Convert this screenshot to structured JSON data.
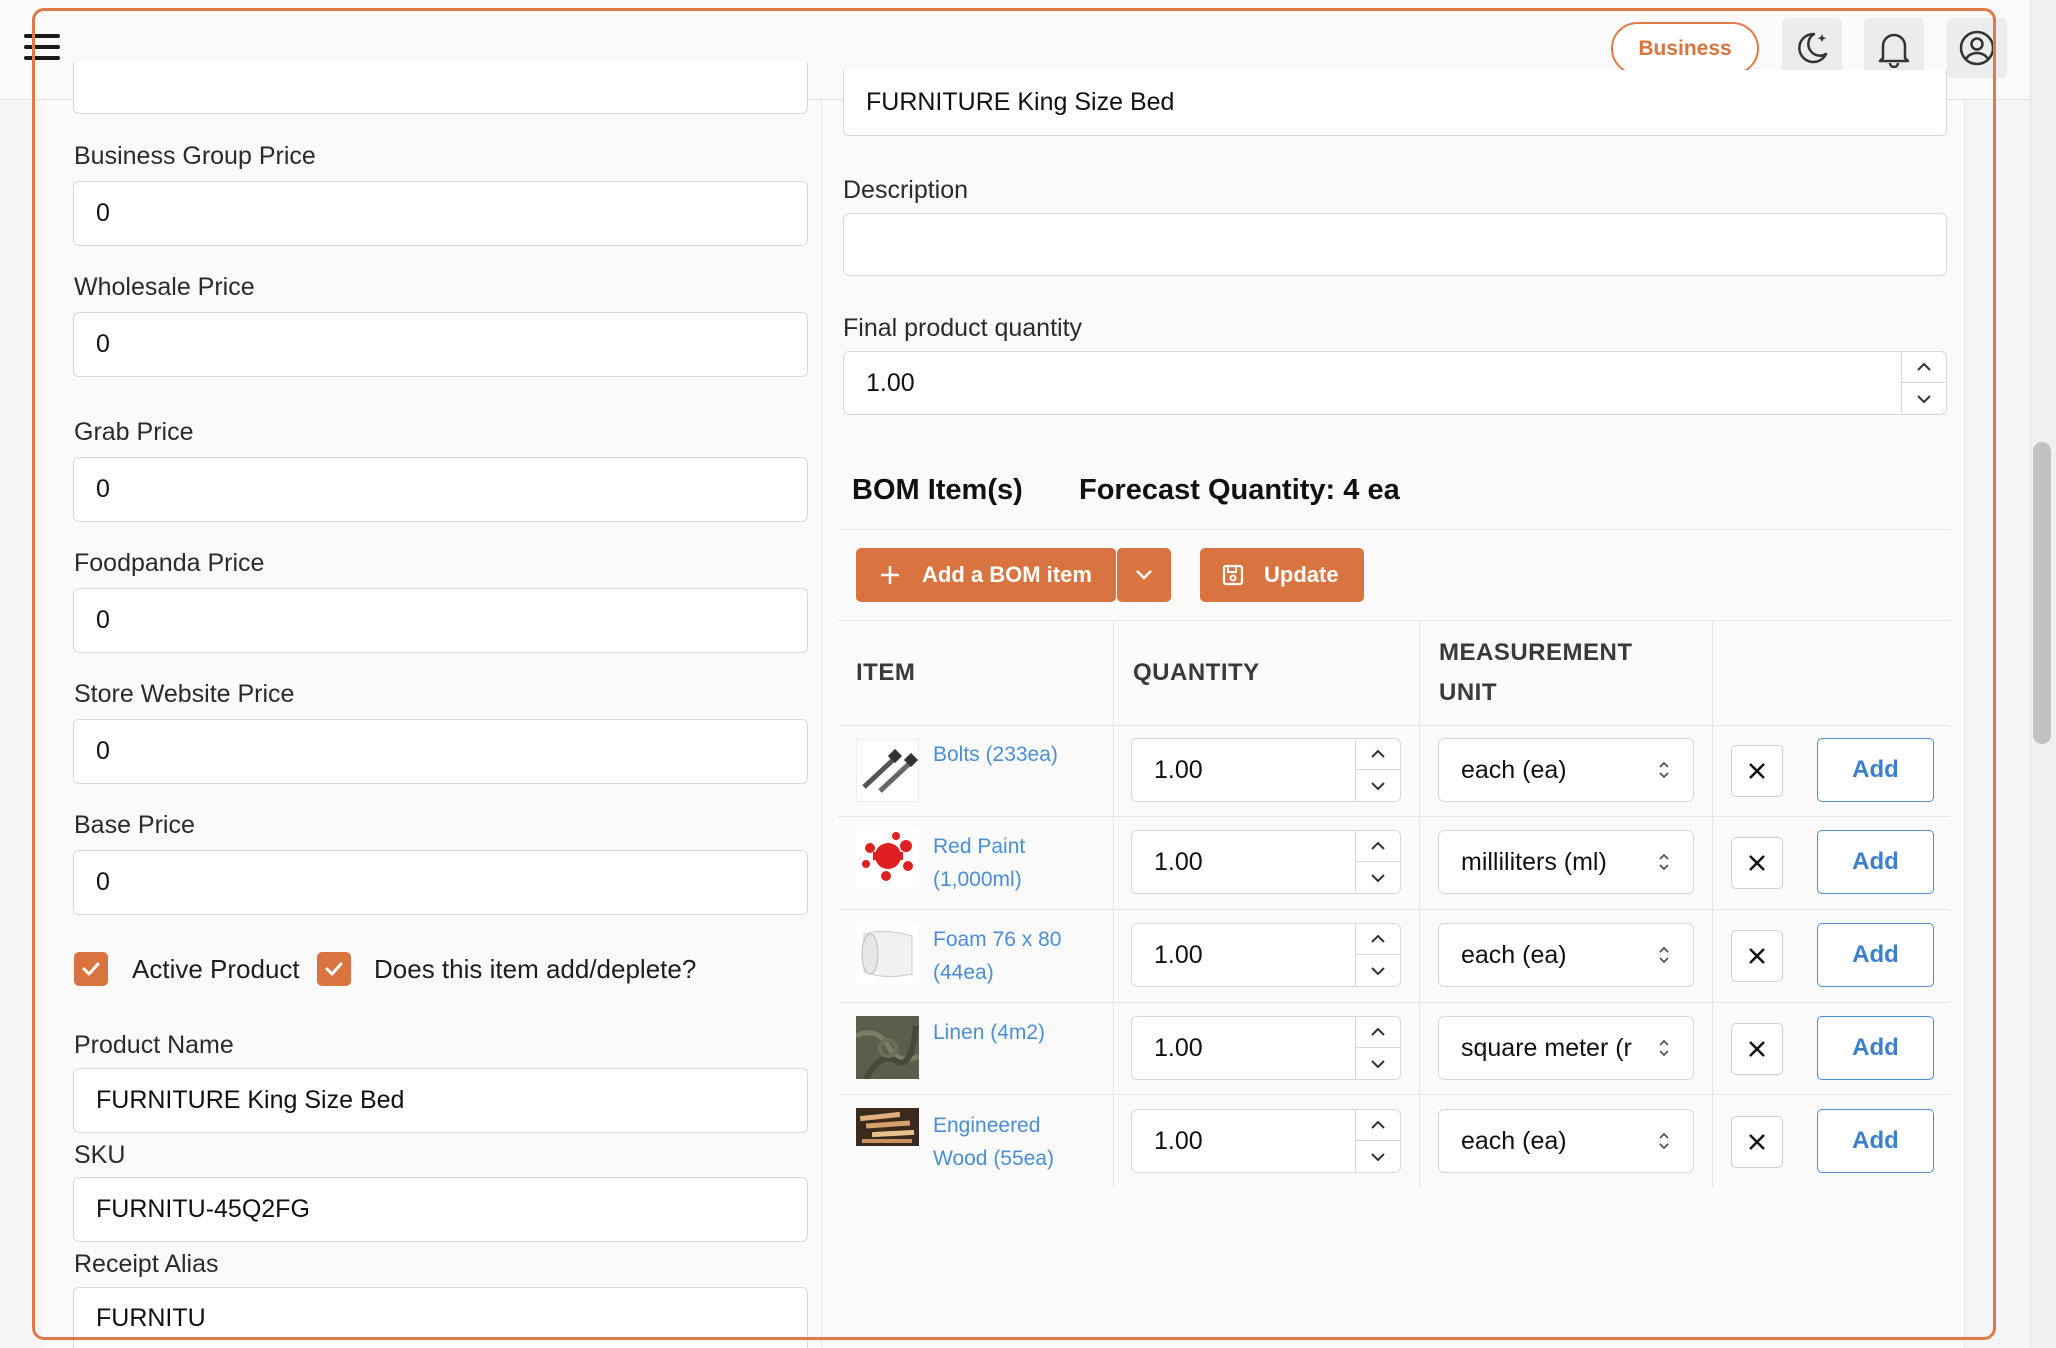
{
  "header": {
    "business_label": "Business",
    "icons": [
      "menu-icon",
      "moon-icon",
      "bell-icon",
      "user-icon"
    ]
  },
  "left": {
    "fields": [
      {
        "label": "Business Group Price",
        "value": "0"
      },
      {
        "label": "Wholesale Price",
        "value": "0"
      },
      {
        "label": "Grab Price",
        "value": "0"
      },
      {
        "label": "Foodpanda Price",
        "value": "0"
      },
      {
        "label": "Store Website Price",
        "value": "0"
      },
      {
        "label": "Base Price",
        "value": "0"
      }
    ],
    "active_product_label": "Active Product",
    "add_deplete_label": "Does this item add/deplete?",
    "product_name_label": "Product Name",
    "product_name_value": "FURNITURE King Size Bed",
    "sku_label": "SKU",
    "sku_value": "FURNITU-45Q2FG",
    "receipt_alias_label": "Receipt Alias",
    "receipt_alias_value": "FURNITU"
  },
  "right": {
    "name_value": "FURNITURE King Size Bed",
    "description_label": "Description",
    "description_value": "",
    "final_qty_label": "Final product quantity",
    "final_qty_value": "1.00",
    "bom_title": "BOM Item(s)",
    "forecast_label": "Forecast Quantity: 4 ea",
    "add_bom_label": "Add a BOM item",
    "update_label": "Update",
    "columns": [
      "ITEM",
      "QUANTITY",
      "MEASUREMENT",
      "UNIT"
    ],
    "rows": [
      {
        "line1": "Bolts (233ea)",
        "line2": "",
        "qty": "1.00",
        "unit": "each (ea)",
        "add": "Add"
      },
      {
        "line1": "Red Paint",
        "line2": "(1,000ml)",
        "qty": "1.00",
        "unit": "milliliters (ml)",
        "add": "Add"
      },
      {
        "line1": "Foam 76 x 80",
        "line2": "(44ea)",
        "qty": "1.00",
        "unit": "each (ea)",
        "add": "Add"
      },
      {
        "line1": "Linen (4m2)",
        "line2": "",
        "qty": "1.00",
        "unit": "square meter (r",
        "add": "Add"
      },
      {
        "line1": "Engineered",
        "line2": "Wood (55ea)",
        "qty": "1.00",
        "unit": "each (ea)",
        "add": "Add"
      }
    ]
  },
  "colors": {
    "accent": "#d9733f",
    "link": "#4a8fd6"
  }
}
